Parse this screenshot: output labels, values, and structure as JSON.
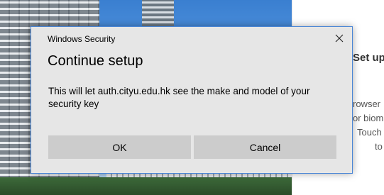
{
  "dialog": {
    "window_title": "Windows Security",
    "heading": "Continue setup",
    "message": "This will let auth.cityu.edu.hk see the make and model of your security key",
    "ok_label": "OK",
    "cancel_label": "Cancel",
    "close_icon": "close-icon",
    "accent_border": "#4a86d6",
    "background": "#e6e6e6",
    "button_color": "#cccccc"
  },
  "background_page": {
    "heading": "Set up",
    "lines": [
      "rowser",
      "or biom",
      "Touch",
      "to"
    ]
  }
}
